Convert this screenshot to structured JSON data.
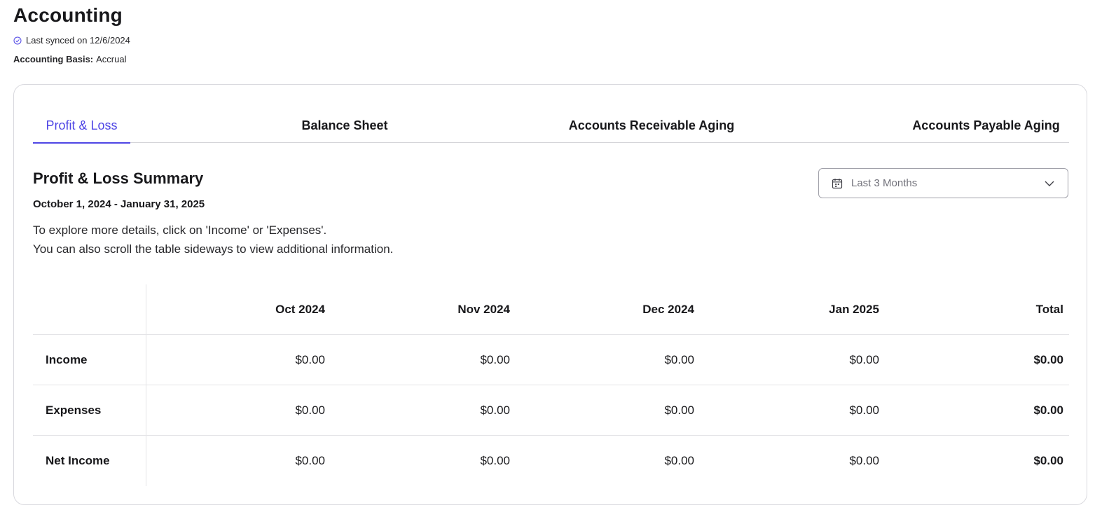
{
  "header": {
    "title": "Accounting",
    "sync_text": "Last synced on 12/6/2024",
    "basis_label": "Accounting Basis:",
    "basis_value": "Accrual"
  },
  "tabs": [
    {
      "label": "Profit & Loss",
      "active": true
    },
    {
      "label": "Balance Sheet",
      "active": false
    },
    {
      "label": "Accounts Receivable Aging",
      "active": false
    },
    {
      "label": "Accounts Payable Aging",
      "active": false
    }
  ],
  "summary": {
    "title": "Profit & Loss Summary",
    "date_range": "October 1, 2024 - January 31, 2025",
    "help_line_1": "To explore more details, click on 'Income' or 'Expenses'.",
    "help_line_2": "You can also scroll the table sideways to view additional information."
  },
  "period_select": {
    "icon": "calendar-icon",
    "value": "Last 3 Months"
  },
  "table": {
    "columns": [
      "Oct 2024",
      "Nov 2024",
      "Dec 2024",
      "Jan 2025",
      "Total"
    ],
    "rows": [
      {
        "label": "Income",
        "values": [
          "$0.00",
          "$0.00",
          "$0.00",
          "$0.00",
          "$0.00"
        ]
      },
      {
        "label": "Expenses",
        "values": [
          "$0.00",
          "$0.00",
          "$0.00",
          "$0.00",
          "$0.00"
        ]
      },
      {
        "label": "Net Income",
        "values": [
          "$0.00",
          "$0.00",
          "$0.00",
          "$0.00",
          "$0.00"
        ]
      }
    ]
  },
  "colors": {
    "accent": "#4f46e5",
    "text": "#18181b",
    "border": "#d9d9de"
  }
}
